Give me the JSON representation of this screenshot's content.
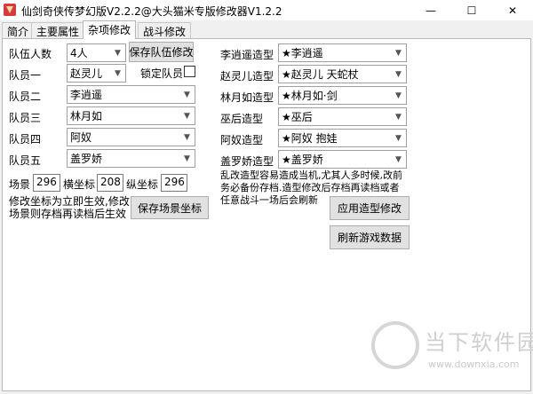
{
  "window": {
    "title": "仙剑奇侠传梦幻版V2.2.2@大头猫米专版修改器V1.2.2",
    "minimize_glyph": "—",
    "maximize_glyph": "☐",
    "close_glyph": "✕"
  },
  "tabs": [
    {
      "label": "简介"
    },
    {
      "label": "主要属性"
    },
    {
      "label": "杂项修改"
    },
    {
      "label": "战斗修改"
    }
  ],
  "party": {
    "count_label": "队伍人数",
    "count_value": "4人",
    "save_button": "保存队伍修改",
    "lock_label": "锁定队员",
    "members": [
      {
        "label": "队员一",
        "value": "赵灵儿"
      },
      {
        "label": "队员二",
        "value": "李逍遥"
      },
      {
        "label": "队员三",
        "value": "林月如"
      },
      {
        "label": "队员四",
        "value": "阿奴"
      },
      {
        "label": "队员五",
        "value": "盖罗娇"
      }
    ]
  },
  "scene": {
    "scene_label": "场景",
    "scene_value": "296",
    "x_label": "横坐标",
    "x_value": "208",
    "y_label": "纵坐标",
    "y_value": "296",
    "note": "修改坐标为立即生效,修改\n场景则存档再读档后生效",
    "save_button": "保存场景坐标"
  },
  "models": {
    "rows": [
      {
        "label": "李逍遥造型",
        "value": "★李逍遥"
      },
      {
        "label": "赵灵儿造型",
        "value": "★赵灵儿 天蛇杖"
      },
      {
        "label": "林月如造型",
        "value": "★林月如·剑"
      },
      {
        "label": "巫后造型",
        "value": "★巫后"
      },
      {
        "label": "阿奴造型",
        "value": "★阿奴 抱娃"
      },
      {
        "label": "盖罗娇造型",
        "value": "★盖罗娇"
      }
    ],
    "warning": "乱改造型容易造成当机,尤其人多时候,改前\n务必备份存档.造型修改后存档再读档或者\n任意战斗一场后会刷新",
    "apply_button": "应用造型修改",
    "refresh_button": "刷新游戏数据"
  },
  "watermark": {
    "text": "当下软件园",
    "url": "www.downxia.com"
  },
  "colors": {
    "window_bg": "#f0f0f0",
    "panel_bg": "#ffffff",
    "button_bg": "#e1e1e1",
    "app_icon_red": "#d33c3c"
  }
}
